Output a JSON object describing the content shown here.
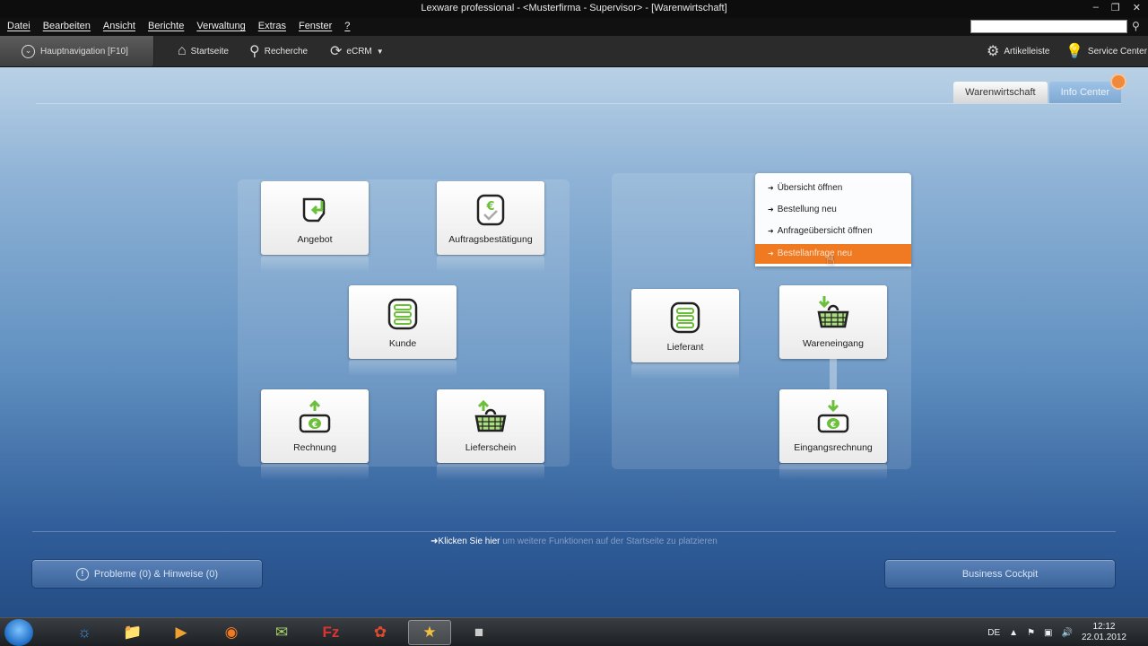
{
  "window": {
    "title": "Lexware professional - <Musterfirma - Supervisor> - [Warenwirtschaft]",
    "minimize": "–",
    "restore": "❐",
    "close": "✕"
  },
  "menu": {
    "items": [
      "Datei",
      "Bearbeiten",
      "Ansicht",
      "Berichte",
      "Verwaltung",
      "Extras",
      "Fenster",
      "?"
    ],
    "search_placeholder": ""
  },
  "toolbar": {
    "nav_label": "Hauptnavigation [F10]",
    "startseite": "Startseite",
    "recherche": "Recherche",
    "ecrm": "eCRM",
    "artikelleiste": "Artikelleiste",
    "service_center": "Service Center"
  },
  "tabs": {
    "warenwirtschaft": "Warenwirtschaft",
    "info_center": "Info Center"
  },
  "tiles": {
    "angebot": "Angebot",
    "auftragsbestaetigung": "Auftragsbestätigung",
    "kunde": "Kunde",
    "rechnung": "Rechnung",
    "lieferschein": "Lieferschein",
    "lieferant": "Lieferant",
    "wareneingang": "Wareneingang",
    "eingangsrechnung": "Eingangsrechnung"
  },
  "context_menu": {
    "items": [
      "Übersicht öffnen",
      "Bestellung neu",
      "Anfrageübersicht öffnen",
      "Bestellanfrage neu"
    ]
  },
  "hint": {
    "link": "Klicken Sie hier",
    "rest": "um weitere Funktionen auf der Startseite zu platzieren"
  },
  "buttons": {
    "probleme": "Probleme (0) & Hinweise (0)",
    "business_cockpit": "Business Cockpit"
  },
  "taskbar": {
    "language": "DE",
    "time": "12:12",
    "date": "22.01.2012"
  },
  "colors": {
    "accent_orange": "#f07a22",
    "icon_green": "#6bbf3a"
  }
}
